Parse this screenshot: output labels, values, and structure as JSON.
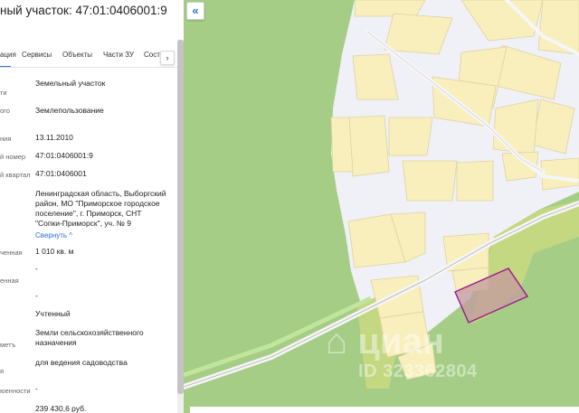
{
  "panel": {
    "title": "ный участок: 47:01:0406001:9",
    "tabs": [
      "ация",
      "Сервисы",
      "Объекты",
      "Части ЗУ",
      "Состa"
    ],
    "tab_next": "›",
    "fields": [
      {
        "label": "ти",
        "value": "Земельный участок"
      },
      {
        "label": "ого",
        "value": "Землепользование"
      },
      {
        "label": "ния",
        "value": "13.11.2010"
      },
      {
        "label": "й номер",
        "value": "47:01:0406001:9"
      },
      {
        "label": "й квартал",
        "value": "47:01:0406001"
      },
      {
        "label": "",
        "value_lines": [
          "Ленинградская область, Выборгский",
          "район, МО \"Приморское городское",
          "поселение\", г. Приморск, СНТ",
          "\"Сопки-Приморск\", уч. № 9"
        ]
      },
      {
        "label": "ченная",
        "value": "1 010 кв. м"
      },
      {
        "label": "енная",
        "value": "-"
      },
      {
        "label": "",
        "value": "-"
      },
      {
        "label": "",
        "value": "Учтенный"
      },
      {
        "label": "метъ",
        "value_lines": [
          "Земли сельскохозяйственного",
          "назначения"
        ]
      },
      {
        "label": "я",
        "value": "для ведения садоводства"
      },
      {
        "label": "юенности",
        "value": "-"
      },
      {
        "label": "",
        "value": "239 430,6 руб."
      }
    ],
    "collapse_link": "Свернуть ^"
  },
  "map": {
    "collapse_button": "«",
    "watermark_logo": "⌂ циан",
    "watermark_id": "ID 323362804",
    "colors": {
      "forest": "#a5cd86",
      "plot": "#f8efbd",
      "plot_border": "#ddd3a0",
      "road": "#f2f2f2",
      "empty": "#f0f0f7",
      "selected_fill": "#c49aa0",
      "selected_stroke": "#a0178a",
      "green_zone": "#c3d881"
    }
  }
}
